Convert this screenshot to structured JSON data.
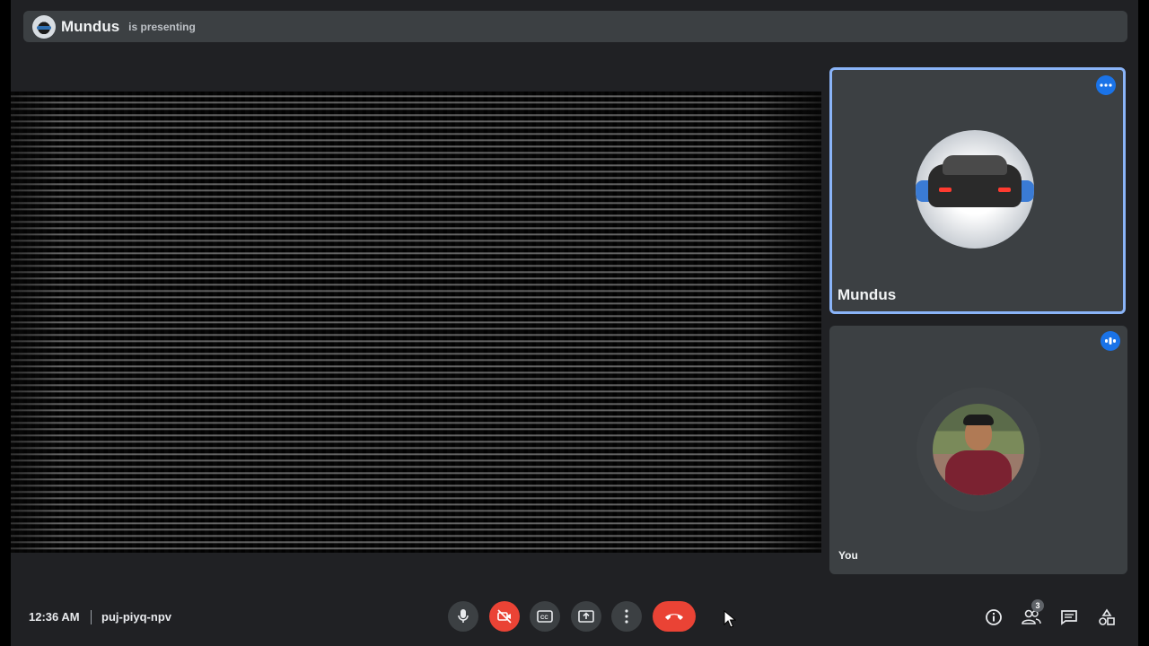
{
  "presenter_bar": {
    "name": "Mundus",
    "status": "is presenting"
  },
  "participants": [
    {
      "name": "Mundus",
      "menu_icon": "more-horiz-icon",
      "highlighted": true
    },
    {
      "name": "You",
      "menu_icon": "audio-level-icon",
      "highlighted": false
    }
  ],
  "bottom_bar": {
    "time": "12:36 AM",
    "meeting_code": "puj-piyq-npv",
    "controls": [
      {
        "icon": "mic-icon",
        "state": "on"
      },
      {
        "icon": "camera-off-icon",
        "state": "off"
      },
      {
        "icon": "captions-icon",
        "state": "off"
      },
      {
        "icon": "present-screen-icon",
        "state": "off"
      },
      {
        "icon": "more-vert-icon",
        "state": "off"
      },
      {
        "icon": "end-call-icon",
        "state": "end"
      }
    ],
    "right_icons": [
      {
        "icon": "info-icon"
      },
      {
        "icon": "people-icon",
        "badge": "3"
      },
      {
        "icon": "chat-icon"
      },
      {
        "icon": "activities-icon"
      }
    ]
  },
  "colors": {
    "accent": "#8ab4f8",
    "danger": "#ea4335",
    "tile_bg": "#3c4043",
    "page_bg": "#202124"
  }
}
